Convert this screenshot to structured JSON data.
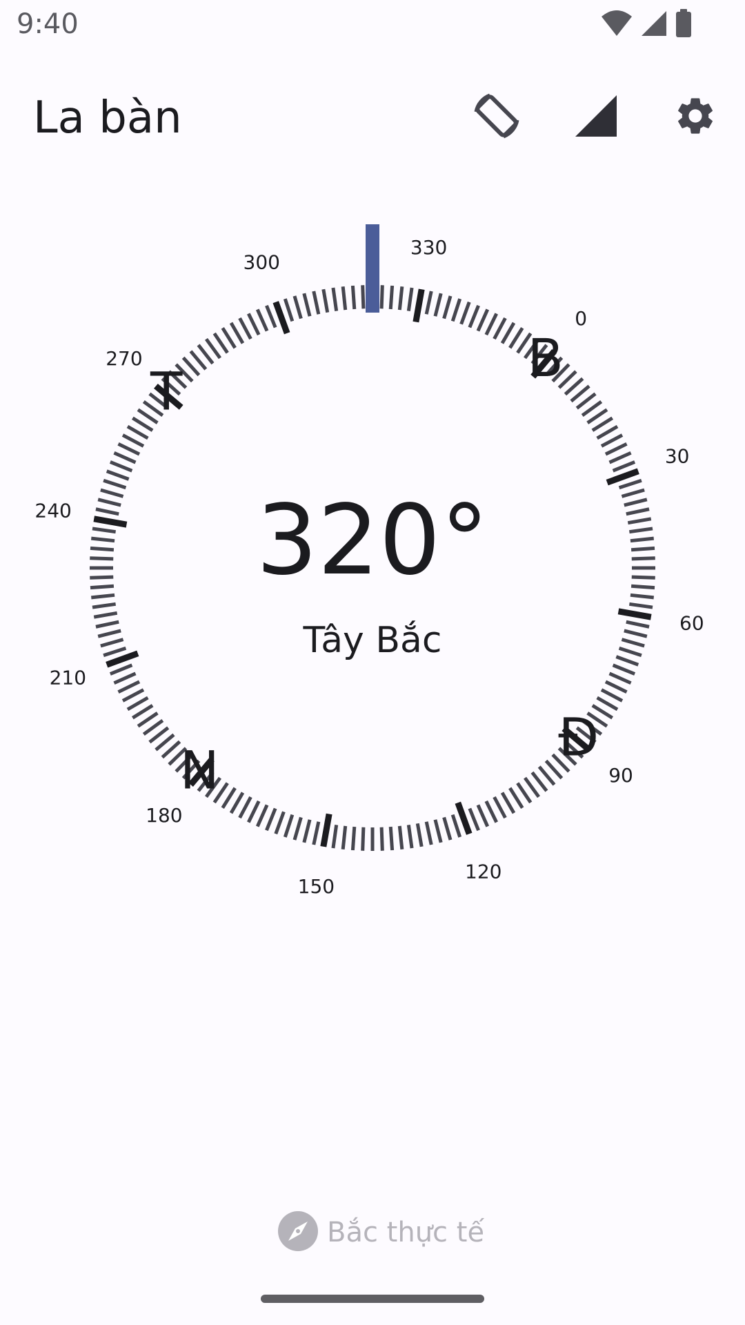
{
  "status_bar": {
    "time": "9:40",
    "icons": [
      "wifi-icon",
      "cell-signal-icon",
      "battery-icon"
    ]
  },
  "app_bar": {
    "title": "La bàn",
    "actions": [
      {
        "name": "screen-rotate-icon",
        "label": "Rotate"
      },
      {
        "name": "signal-quality-icon",
        "label": "Signal"
      },
      {
        "name": "settings-icon",
        "label": "Settings"
      }
    ]
  },
  "compass": {
    "heading_display": "320°",
    "heading_degrees": 320,
    "direction_label": "Tây Bắc",
    "cardinals": {
      "north": "B",
      "east": "Đ",
      "south": "N",
      "west": "T"
    },
    "degree_labels": [
      "0",
      "30",
      "60",
      "90",
      "120",
      "150",
      "180",
      "210",
      "240",
      "270",
      "300",
      "330"
    ],
    "indicator_color": "#4b5d99",
    "major_tick_color": "#1b1b1f",
    "minor_tick_color": "#46464f"
  },
  "footer": {
    "true_north_label": "Bắc thực tế",
    "true_north_enabled": false
  }
}
